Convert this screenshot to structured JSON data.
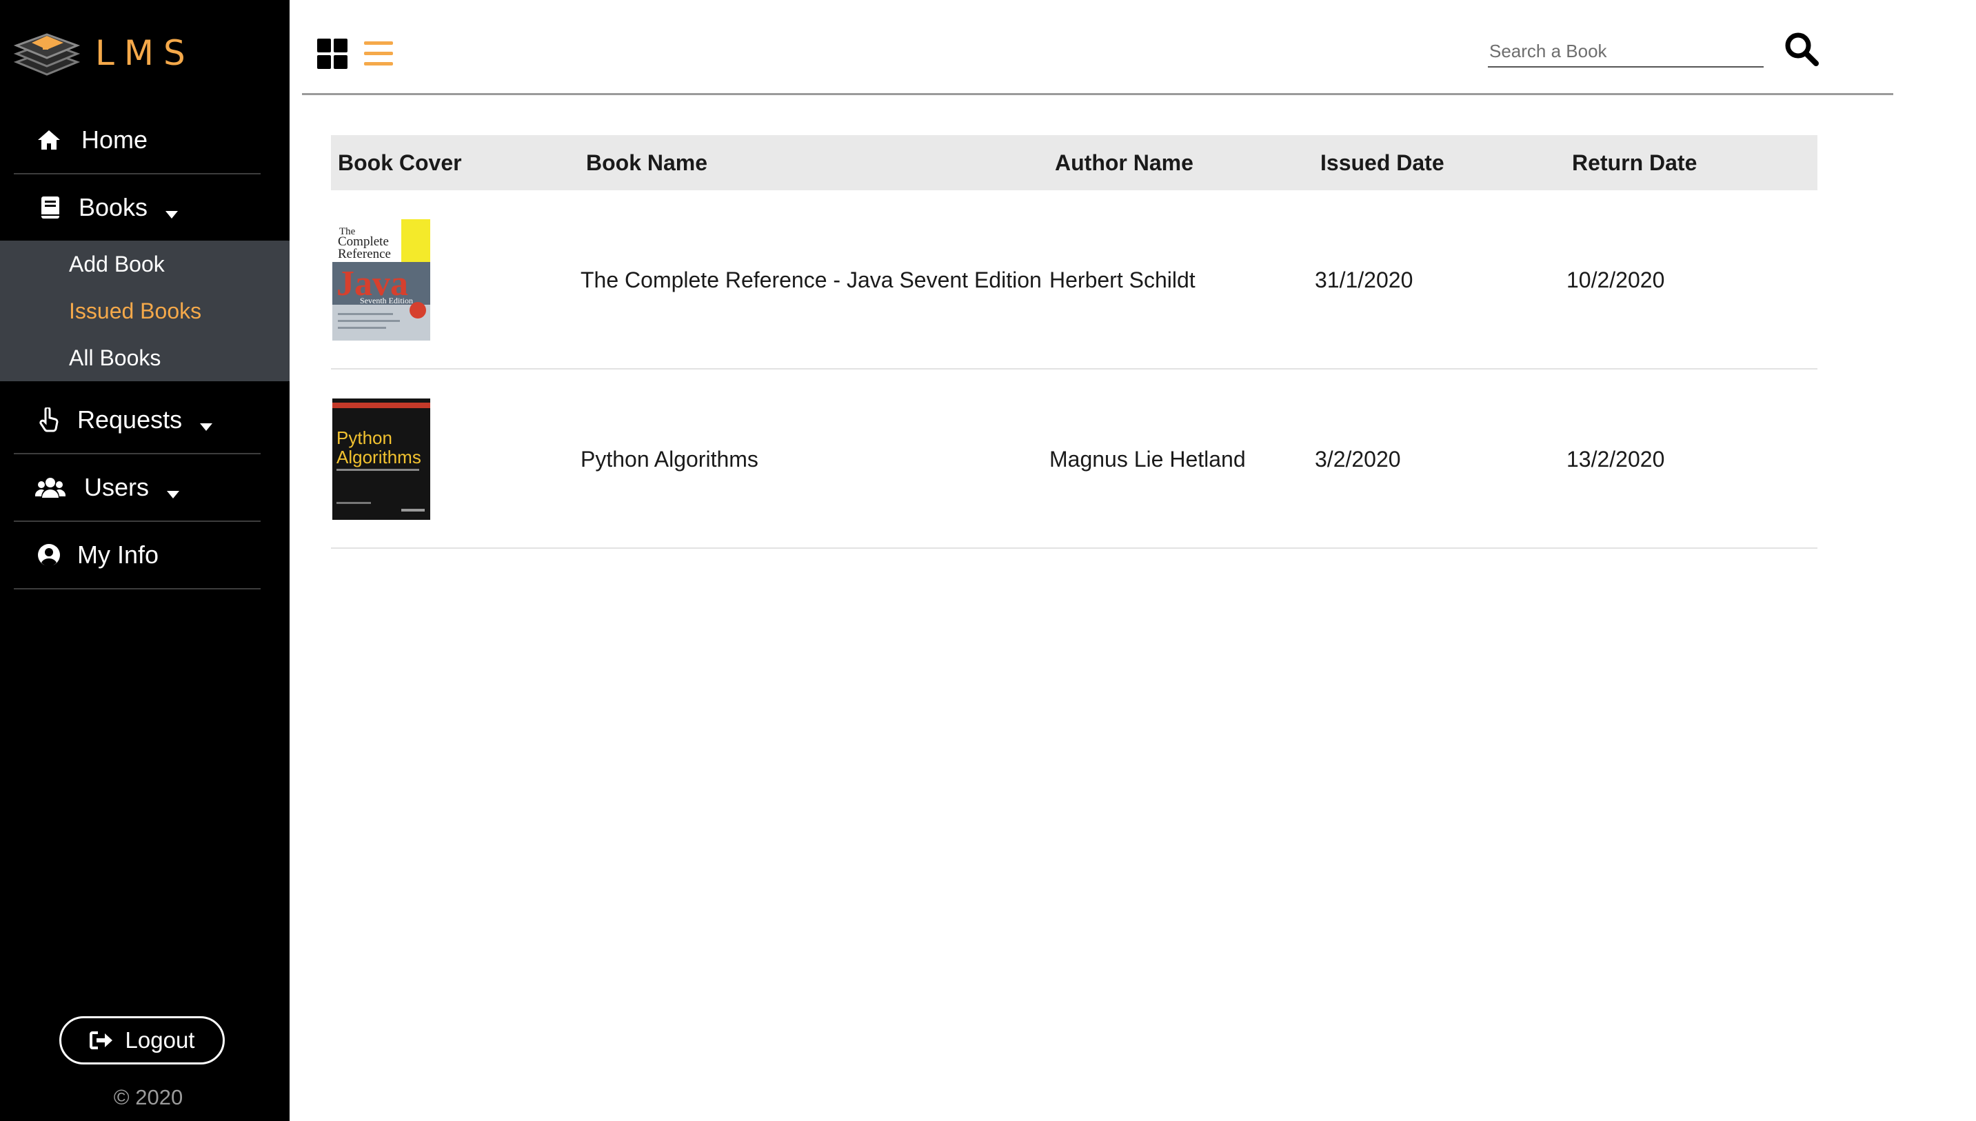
{
  "brand": {
    "name": "LMS",
    "logo": "books-stack-logo"
  },
  "sidebar": {
    "items": [
      {
        "label": "Home",
        "icon": "home-icon"
      },
      {
        "label": "Books",
        "icon": "book-icon",
        "expanded": true,
        "children": [
          {
            "label": "Add Book",
            "active": false
          },
          {
            "label": "Issued Books",
            "active": true
          },
          {
            "label": "All Books",
            "active": false
          }
        ]
      },
      {
        "label": "Requests",
        "icon": "hand-pointer-icon"
      },
      {
        "label": "Users",
        "icon": "users-icon"
      },
      {
        "label": "My Info",
        "icon": "user-circle-icon"
      }
    ],
    "logout_label": "Logout",
    "copyright": "© 2020"
  },
  "toolbar": {
    "grid_view_icon": "grid-view-icon",
    "list_view_icon": "list-view-icon",
    "active_view": "list",
    "search_placeholder": "Search a Book",
    "search_value": ""
  },
  "table": {
    "columns": [
      "Book Cover",
      "Book Name",
      "Author Name",
      "Issued Date",
      "Return Date"
    ],
    "rows": [
      {
        "cover": "java-complete-reference-cover",
        "name": "The Complete Reference - Java Sevent Edition",
        "author": "Herbert Schildt",
        "issued": "31/1/2020",
        "return": "10/2/2020"
      },
      {
        "cover": "python-algorithms-cover",
        "name": "Python Algorithms",
        "author": "Magnus Lie Hetland",
        "issued": "3/2/2020",
        "return": "13/2/2020"
      }
    ]
  },
  "colors": {
    "accent": "#f5a94a",
    "sidebar_bg": "#000000",
    "submenu_bg": "#3c4046",
    "header_bg": "#e9e9e9"
  }
}
